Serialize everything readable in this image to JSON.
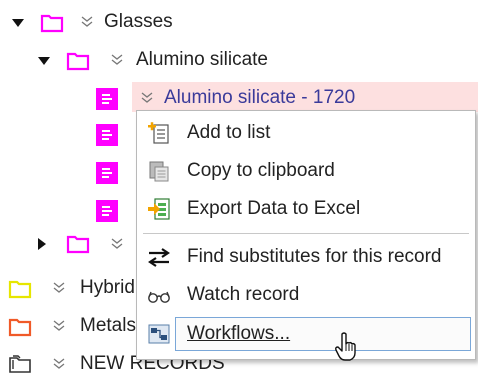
{
  "tree": {
    "glasses": "Glasses",
    "alumino": "Alumino silicate",
    "selected_record": "Alumino silicate - 1720",
    "hybrid": "Hybrid",
    "metals": "Metals",
    "new_records": "NEW RECORDS"
  },
  "context_menu": {
    "add_to_list": "Add to list",
    "copy_to_clipboard": "Copy to clipboard",
    "export_excel": "Export Data to Excel",
    "find_substitutes": "Find substitutes for this record",
    "watch_record": "Watch record",
    "workflows": "Workflows..."
  },
  "colors": {
    "magenta": "#ff00ff",
    "yellow_folder": "#e6e600",
    "orange_folder": "#f05a28",
    "selected_text": "#3a3a9a",
    "highlight": "#fde0e0"
  },
  "icons": {
    "expanded": "triangle-down",
    "collapsed": "triangle-right",
    "folder": "folder-outline",
    "record": "record-icon",
    "chevron": "double-chevron-down"
  }
}
